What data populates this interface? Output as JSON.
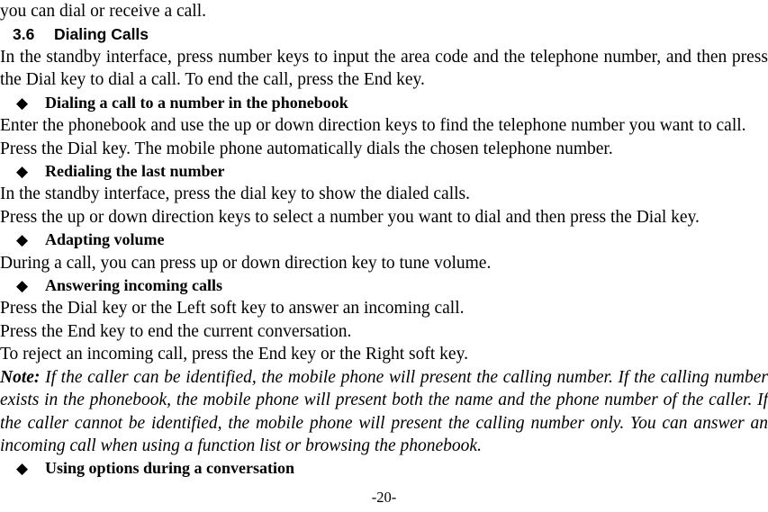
{
  "document": {
    "continuation_line": "you can dial or receive a call.",
    "footer_page_number": "-20-",
    "bullet_glyph": "◆"
  },
  "section": {
    "number": "3.6",
    "title": "Dialing Calls",
    "intro_paragraph": "In the standby interface, press number keys to input the area code and the telephone number, and then press the Dial key to dial a call. To end the call, press the End key."
  },
  "blocks": {
    "phonebook_dial": {
      "heading": "Dialing a call to a number in the phonebook",
      "line1": "Enter the phonebook and use the up or down direction keys to find the telephone number you want to call.",
      "line2": "Press the Dial key. The mobile phone automatically dials the chosen telephone number."
    },
    "redial": {
      "heading": "Redialing the last number",
      "line1": "In the standby interface, press the dial key to show the dialed calls.",
      "line2": "Press the up or down direction keys to select a number you want to dial and then press the Dial key."
    },
    "volume": {
      "heading": "Adapting volume",
      "line1": "During a call, you can press up or down direction key to tune volume."
    },
    "answering": {
      "heading": "Answering incoming calls",
      "line1": "Press the Dial key or the Left soft key to answer an incoming call.",
      "line2": "Press the End key to end the current conversation.",
      "line3": "To reject an incoming call, press the End key or the Right soft key.",
      "note_label": "Note:",
      "note_text": " If the caller can be identified, the mobile phone will present the calling number. If the calling number exists in the phonebook, the mobile phone will present both the name and the phone number of the caller. If the caller cannot be identified, the mobile phone will present the calling number only. You can answer an incoming call when using a function list or browsing the phonebook."
    },
    "options": {
      "heading": "Using options during a conversation"
    }
  }
}
